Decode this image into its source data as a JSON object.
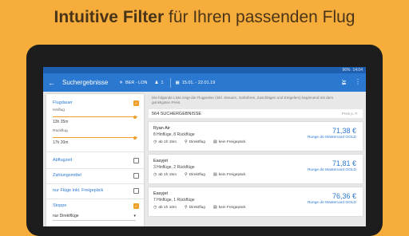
{
  "headline": {
    "bold": "Intuitive Filter",
    "rest": " für Ihren passenden Flug"
  },
  "statusbar": {
    "text": "96%",
    "time": "14:04"
  },
  "appbar": {
    "back_icon": "arrow-left-icon",
    "title": "Suchergebnisse",
    "route": "BER - LON",
    "passengers": "1",
    "dates": "15.01. - 22.01.19"
  },
  "sidebar": {
    "flugdauer": {
      "label": "Flugdauer",
      "checked": true
    },
    "hinflug": {
      "label": "Hinflug",
      "value": "13h 35m",
      "level": 0.97
    },
    "rueckflug": {
      "label": "Rückflug",
      "value": "17h 20m",
      "level": 0.97
    },
    "abflugzeit": {
      "label": "Abflugzeit",
      "checked": false
    },
    "zahlungsmittel": {
      "label": "Zahlungsmittel",
      "checked": false
    },
    "freigepaeck": {
      "label": "nur Flüge inkl. Freigepäck",
      "checked": false
    },
    "stopps": {
      "label": "Stopps",
      "checked": true
    },
    "stopps_select": {
      "value": "nur Direktflüge"
    }
  },
  "results": {
    "note": "Die folgende Liste zeigt die Flugpreise (inkl. Steuern, Gebühren, Zuschlägen und Entgelten) beginnend mit dem günstigsten Preis.",
    "header": "564 SUCHERGEBNISSE",
    "price_per": "Preis p. P.",
    "cards": [
      {
        "airline": "Ryan Air",
        "stops": "8 Hinflüge, 8 Rückflüge",
        "from": "ab 1h 15m",
        "type": "Direktflug",
        "baggage": "kein Freigepäck",
        "price": "71,38 €",
        "cc": "Ruege de Mastercard GOLD"
      },
      {
        "airline": "Easyjet",
        "stops": "3 Hinflüge, 2 Rückflüge",
        "from": "ab 1h 15m",
        "type": "Direktflug",
        "baggage": "kein Freigepäck",
        "price": "71,81 €",
        "cc": "Ruege de Mastercard GOLD"
      },
      {
        "airline": "Easyjet",
        "stops": "7 Hinflüge, 1 Rückflüge",
        "from": "ab 1h 10m",
        "type": "Direktflug",
        "baggage": "kein Freigepäck",
        "price": "76,36 €",
        "cc": "Ruege de Mastercard GOLD"
      }
    ]
  }
}
